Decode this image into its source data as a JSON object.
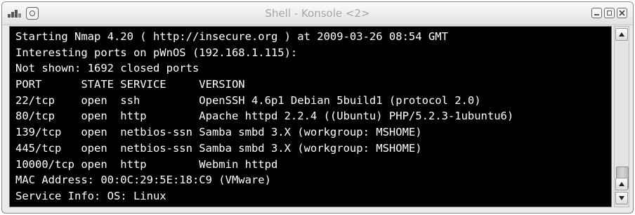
{
  "window": {
    "title": "Shell - Konsole <2>"
  },
  "terminal": {
    "lines": [
      "Starting Nmap 4.20 ( http://insecure.org ) at 2009-03-26 08:54 GMT",
      "Interesting ports on pWnOS (192.168.1.115):",
      "Not shown: 1692 closed ports",
      "PORT      STATE SERVICE     VERSION",
      "22/tcp    open  ssh         OpenSSH 4.6p1 Debian 5build1 (protocol 2.0)",
      "80/tcp    open  http        Apache httpd 2.2.4 ((Ubuntu) PHP/5.2.3-1ubuntu6)",
      "139/tcp   open  netbios-ssn Samba smbd 3.X (workgroup: MSHOME)",
      "445/tcp   open  netbios-ssn Samba smbd 3.X (workgroup: MSHOME)",
      "10000/tcp open  http        Webmin httpd",
      "MAC Address: 00:0C:29:5E:18:C9 (VMware)",
      "Service Info: OS: Linux"
    ],
    "text_color": "#ffffff",
    "background_color": "#000000"
  },
  "icons": {
    "app": "konsole-app-icon",
    "menu": "window-menu-icon",
    "minimize": "minimize-icon",
    "maximize": "maximize-icon",
    "close": "close-icon",
    "scroll_up": "scroll-up-arrow-icon",
    "scroll_down": "scroll-down-arrow-icon"
  }
}
